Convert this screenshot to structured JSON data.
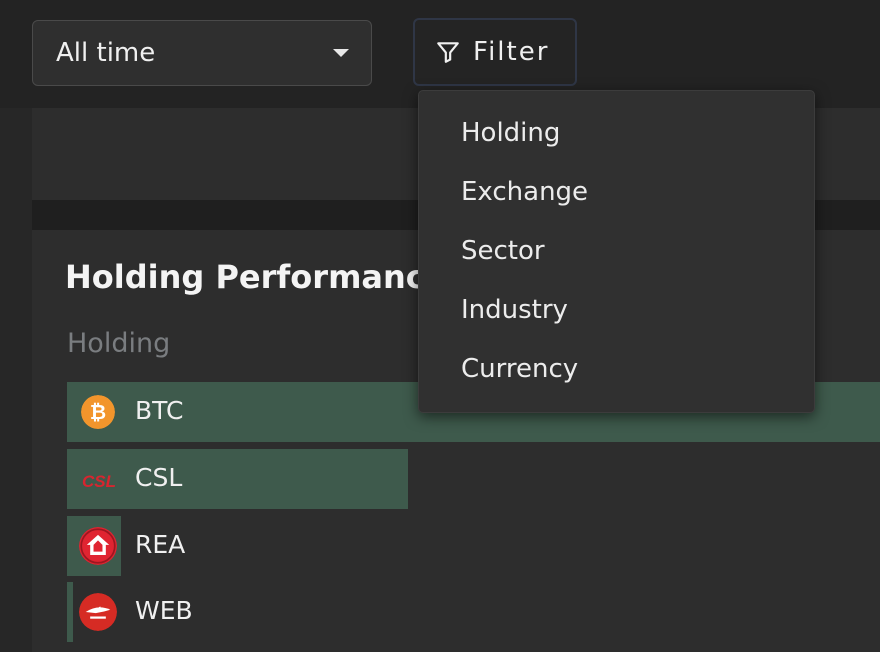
{
  "toolbar": {
    "time_range": "All time",
    "filter_label": "Filter"
  },
  "filter_menu": {
    "items": [
      "Holding",
      "Exchange",
      "Sector",
      "Industry",
      "Currency"
    ]
  },
  "performance": {
    "title": "Holding Performance",
    "column_header": "Holding",
    "rows": [
      {
        "ticker": "BTC",
        "relative_performance": 1.0
      },
      {
        "ticker": "CSL",
        "relative_performance": 0.42
      },
      {
        "ticker": "REA",
        "relative_performance": 0.067
      },
      {
        "ticker": "WEB",
        "relative_performance": 0.007
      }
    ]
  },
  "logos": {
    "btc": {
      "color": "#f2952c",
      "glyph": "₿"
    },
    "csl": {
      "color": "#d7252f",
      "text": "CSL"
    },
    "rea": {
      "color": "#e02431"
    },
    "web": {
      "color": "#d62b24"
    }
  },
  "colors": {
    "bar": "#3e5a4c",
    "card": "#2d2d2d"
  }
}
